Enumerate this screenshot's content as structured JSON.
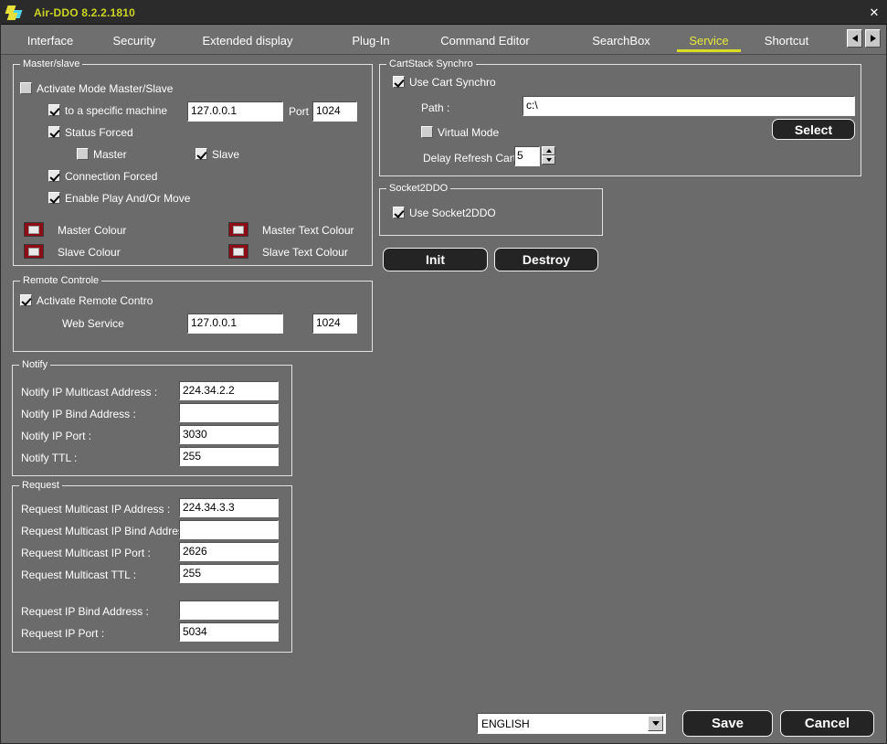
{
  "window": {
    "title": "Air-DDO 8.2.2.1810",
    "close_label": "✕",
    "logo_icon": "diamond-logo-icon"
  },
  "tabs": {
    "items": [
      {
        "label": "Interface",
        "active": false
      },
      {
        "label": "Security",
        "active": false
      },
      {
        "label": "Extended display",
        "active": false
      },
      {
        "label": "Plug-In",
        "active": false
      },
      {
        "label": "Command Editor",
        "active": false
      },
      {
        "label": "SearchBox",
        "active": false
      },
      {
        "label": "Service",
        "active": true
      },
      {
        "label": "Shortcut",
        "active": false
      }
    ],
    "nav_prev_icon": "arrow-left-icon",
    "nav_next_icon": "arrow-right-icon"
  },
  "master_slave": {
    "legend": "Master/slave",
    "activate": {
      "label": "Activate Mode Master/Slave",
      "checked": false
    },
    "specific_machine": {
      "label": "to a specific machine",
      "checked": true
    },
    "machine_address": "127.0.0.1",
    "port_label": "Port",
    "port_value": "1024",
    "status_forced": {
      "label": "Status Forced",
      "checked": true
    },
    "master": {
      "label": "Master",
      "checked": false
    },
    "slave": {
      "label": "Slave",
      "checked": true
    },
    "connection_forced": {
      "label": "Connection Forced",
      "checked": true
    },
    "enable_play": {
      "label": "Enable Play And/Or Move",
      "checked": true
    },
    "colours": [
      {
        "label": "Master Colour",
        "swatch": "#8d0d16"
      },
      {
        "label": "Slave Colour",
        "swatch": "#8d0d16"
      },
      {
        "label": "Master Text Colour",
        "swatch": "#8d0d16"
      },
      {
        "label": "Slave Text Colour",
        "swatch": "#8d0d16"
      }
    ]
  },
  "remote_controle": {
    "legend": "Remote Controle",
    "activate": {
      "label": "Activate Remote Contro",
      "checked": true
    },
    "web_service_label": "Web Service",
    "web_service_address": "127.0.0.1",
    "web_service_port": "1024"
  },
  "notify": {
    "legend": "Notify",
    "rows": [
      {
        "label": "Notify IP Multicast Address :",
        "value": "224.34.2.2"
      },
      {
        "label": "Notify IP Bind Address :",
        "value": ""
      },
      {
        "label": "Notify IP Port :",
        "value": "3030"
      },
      {
        "label": "Notify TTL :",
        "value": "255"
      }
    ]
  },
  "request": {
    "legend": "Request",
    "rows": [
      {
        "label": "Request Multicast IP Address :",
        "value": "224.34.3.3"
      },
      {
        "label": "Request Multicast IP Bind Address :",
        "value": ""
      },
      {
        "label": "Request Multicast IP Port :",
        "value": "2626"
      },
      {
        "label": "Request Multicast TTL :",
        "value": "255"
      },
      {
        "label": "Request IP Bind Address :",
        "value": ""
      },
      {
        "label": "Request IP Port :",
        "value": "5034"
      }
    ]
  },
  "cartstack": {
    "legend": "CartStack Synchro",
    "use_cart": {
      "label": "Use Cart Synchro",
      "checked": true
    },
    "path_label": "Path :",
    "path_value": "c:\\",
    "select_button": "Select",
    "virtual_mode": {
      "label": "Virtual Mode",
      "checked": false
    },
    "delay_label": "Delay Refresh Cart",
    "delay_value": "5",
    "spin_up_icon": "spinner-up-icon",
    "spin_down_icon": "spinner-down-icon"
  },
  "socket2ddo": {
    "legend": "Socket2DDO",
    "use_socket": {
      "label": "Use Socket2DDO",
      "checked": true
    },
    "init_button": "Init",
    "destroy_button": "Destroy"
  },
  "footer": {
    "language_value": "ENGLISH",
    "language_arrow_icon": "chevron-down-icon",
    "save_button": "Save",
    "cancel_button": "Cancel"
  },
  "colors": {
    "background": "#6b6b6b",
    "titlebar": "#2b2b2b",
    "accent": "#ccd422",
    "swatch_red": "#8d0d16",
    "button_dark": "#242424"
  }
}
